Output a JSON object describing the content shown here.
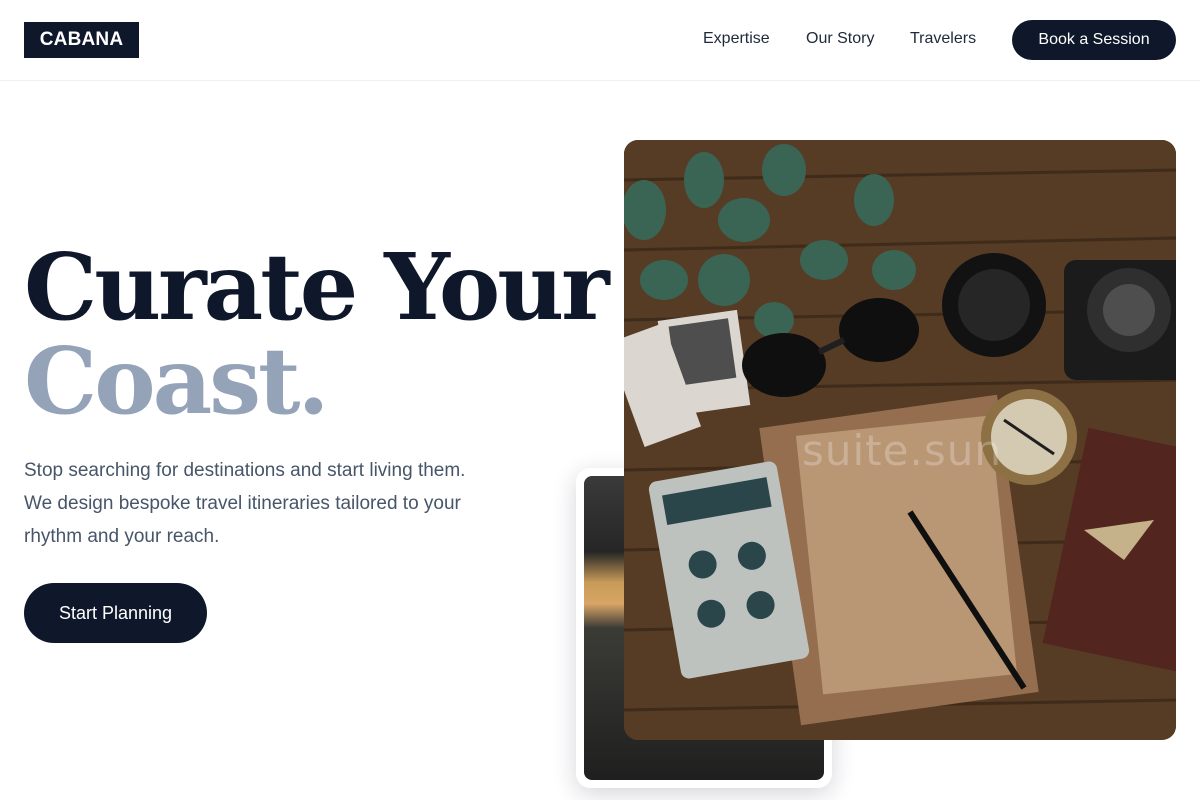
{
  "header": {
    "logo": "CABANA",
    "nav": [
      "Expertise",
      "Our Story",
      "Travelers"
    ],
    "book_button": "Book a Session"
  },
  "hero": {
    "headline_line1": "Curate Your",
    "headline_line2": "Coast.",
    "subtext": "Stop searching for destinations and start living them. We design bespoke travel itineraries tailored to your rhythm and your reach.",
    "cta": "Start Planning"
  },
  "images": {
    "main_photo_watermark": "suite.sun",
    "main_photo": "travel-flatlay-photo",
    "secondary_photo": "car-interior-photo"
  },
  "colors": {
    "primary": "#0f172a",
    "headline_muted": "#94a3b8",
    "body_text": "#475569"
  }
}
